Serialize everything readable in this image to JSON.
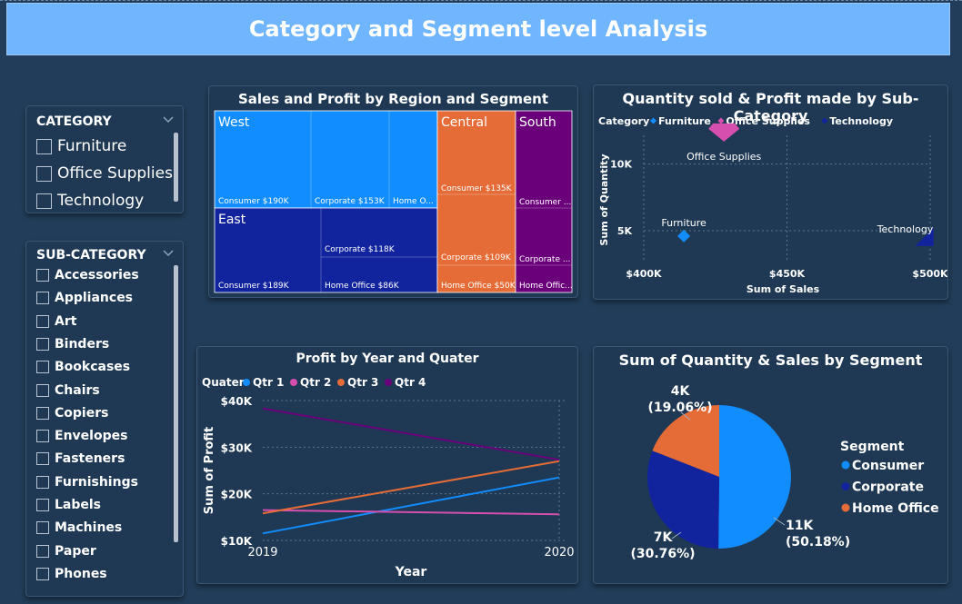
{
  "header": {
    "title": "Category and Segment level Analysis"
  },
  "category_slicer": {
    "title": "CATEGORY",
    "items": [
      "Furniture",
      "Office Supplies",
      "Technology"
    ]
  },
  "subcategory_slicer": {
    "title": "SUB-CATEGORY",
    "items": [
      "Accessories",
      "Appliances",
      "Art",
      "Binders",
      "Bookcases",
      "Chairs",
      "Copiers",
      "Envelopes",
      "Fasteners",
      "Furnishings",
      "Labels",
      "Machines",
      "Paper",
      "Phones"
    ]
  },
  "treemap": {
    "title": "Sales and Profit by Region and Segment",
    "regions": [
      {
        "name": "West",
        "color": "#118dff",
        "cells": [
          {
            "label": "Consumer $190K",
            "value": 190
          },
          {
            "label": "Corporate $153K",
            "value": 153
          },
          {
            "label": "Home O...",
            "value": 110
          }
        ]
      },
      {
        "name": "East",
        "color": "#12239e",
        "cells": [
          {
            "label": "Consumer $189K",
            "value": 189
          },
          {
            "label": "Corporate $118K",
            "value": 118
          },
          {
            "label": "Home Office $86K",
            "value": 86
          }
        ]
      },
      {
        "name": "Central",
        "color": "#e66c37",
        "cells": [
          {
            "label": "Consumer $135K",
            "value": 135
          },
          {
            "label": "Corporate $109K",
            "value": 109
          },
          {
            "label": "Home Office $50K",
            "value": 50
          }
        ]
      },
      {
        "name": "South",
        "color": "#6b007b",
        "cells": [
          {
            "label": "Consumer ...",
            "value": 100
          },
          {
            "label": "Corporate ...",
            "value": 55
          },
          {
            "label": "Home Offic...",
            "value": 45
          }
        ]
      }
    ]
  },
  "scatter": {
    "title": "Quantity sold & Profit made by Sub-Category",
    "legend_title": "Category",
    "x_label": "Sum of Sales",
    "y_label": "Sum of Quantity",
    "x_ticks": [
      "$400K",
      "$450K",
      "$500K"
    ],
    "y_ticks": [
      "5K",
      "10K"
    ],
    "chart_data": {
      "type": "scatter",
      "xlabel": "Sum of Sales",
      "ylabel": "Sum of Quantity",
      "xlim": [
        400000,
        500000
      ],
      "ylim": [
        3500,
        12500
      ],
      "series": [
        {
          "name": "Furniture",
          "color": "#118dff",
          "marker": "diamond",
          "x": [
            414000
          ],
          "y": [
            4600
          ],
          "label": "Furniture"
        },
        {
          "name": "Office Supplies",
          "color": "#d64fae",
          "marker": "diamond",
          "x": [
            428000
          ],
          "y": [
            12100
          ],
          "label": "Office Supplies"
        },
        {
          "name": "Technology",
          "color": "#12239e",
          "marker": "diamond",
          "x": [
            498000
          ],
          "y": [
            4800
          ],
          "label": "Technology"
        }
      ]
    }
  },
  "line": {
    "title": "Profit by Year and Quater",
    "legend_title": "Quater",
    "x_label": "Year",
    "y_label": "Sum of Profit",
    "y_ticks": [
      "$40K",
      "$30K",
      "$20K",
      "$10K"
    ],
    "chart_data": {
      "type": "line",
      "x": [
        "2019",
        "2020"
      ],
      "ylim": [
        10000,
        40000
      ],
      "xlabel": "Year",
      "ylabel": "Sum of Profit",
      "series": [
        {
          "name": "Qtr 1",
          "color": "#118dff",
          "values": [
            11500,
            23500
          ]
        },
        {
          "name": "Qtr 2",
          "color": "#d64fae",
          "values": [
            16500,
            15600
          ]
        },
        {
          "name": "Qtr 3",
          "color": "#e66c37",
          "values": [
            15800,
            27000
          ]
        },
        {
          "name": "Qtr 4",
          "color": "#6b007b",
          "values": [
            38300,
            27300
          ]
        }
      ]
    }
  },
  "pie": {
    "title": "Sum of Quantity & Sales by Segment",
    "legend_title": "Segment",
    "chart_data": {
      "type": "pie",
      "categories": [
        "Consumer",
        "Corporate",
        "Home Office"
      ],
      "values": [
        50.18,
        30.76,
        19.06
      ],
      "colors": [
        "#118dff",
        "#12239e",
        "#e66c37"
      ],
      "labels": [
        [
          "11K",
          "(50.18%)"
        ],
        [
          "7K",
          "(30.76%)"
        ],
        [
          "4K",
          "(19.06%)"
        ]
      ]
    }
  }
}
